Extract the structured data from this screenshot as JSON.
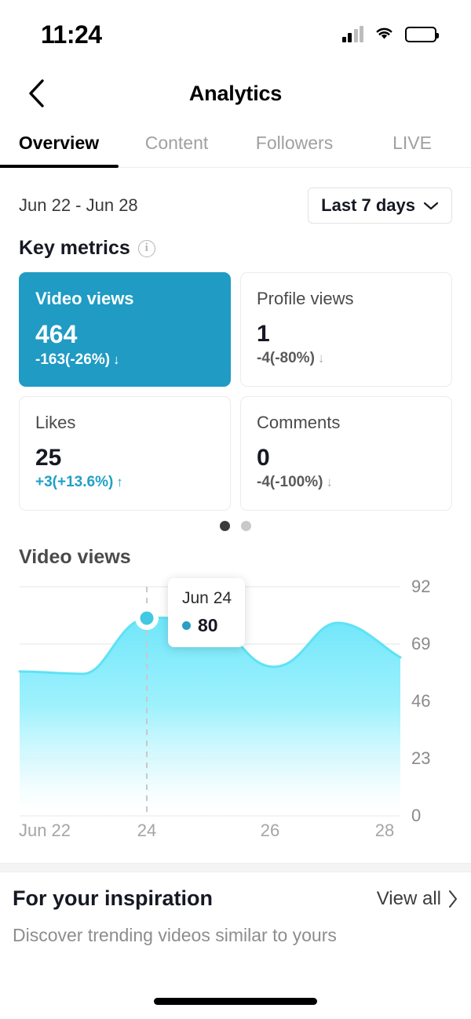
{
  "status_bar": {
    "time": "11:24",
    "signal_icon": "cellular-signal-icon",
    "wifi_icon": "wifi-icon",
    "battery_icon": "battery-icon"
  },
  "nav": {
    "back_icon": "chevron-left-icon",
    "title": "Analytics"
  },
  "tabs": [
    {
      "label": "Overview",
      "active": true
    },
    {
      "label": "Content",
      "active": false
    },
    {
      "label": "Followers",
      "active": false
    },
    {
      "label": "LIVE",
      "active": false
    }
  ],
  "date_row": {
    "range_text": "Jun 22 - Jun 28",
    "picker_label": "Last 7 days",
    "picker_icon": "chevron-down-icon"
  },
  "key_metrics": {
    "heading": "Key metrics",
    "info_icon": "info-circle-icon",
    "info_glyph": "i",
    "cards": [
      {
        "title": "Video views",
        "value": "464",
        "delta": "-163(-26%)",
        "direction": "down",
        "arrow": "↓",
        "selected": true
      },
      {
        "title": "Profile views",
        "value": "1",
        "delta": "-4(-80%)",
        "direction": "down",
        "arrow": "↓",
        "selected": false
      },
      {
        "title": "Likes",
        "value": "25",
        "delta": "+3(+13.6%)",
        "direction": "up",
        "arrow": "↑",
        "selected": false
      },
      {
        "title": "Comments",
        "value": "0",
        "delta": "-4(-100%)",
        "direction": "down",
        "arrow": "↓",
        "selected": false
      }
    ],
    "pager": {
      "total": 2,
      "active_index": 0
    }
  },
  "chart_section": {
    "title": "Video views",
    "tooltip": {
      "date": "Jun 24",
      "value": "80",
      "marker_color": "#2a9ec6"
    }
  },
  "chart_data": {
    "type": "area",
    "title": "Video views",
    "xlabel": "",
    "ylabel": "",
    "x": [
      "Jun 22",
      "Jun 23",
      "Jun 24",
      "Jun 25",
      "Jun 26",
      "Jun 27",
      "Jun 28"
    ],
    "tick_labels_x": [
      "Jun 22",
      "24",
      "26",
      "28"
    ],
    "tick_labels_y": [
      "92",
      "69",
      "46",
      "23",
      "0"
    ],
    "ylim": [
      0,
      92
    ],
    "yticks": [
      0,
      23,
      46,
      69,
      92
    ],
    "grid": true,
    "legend": "none",
    "series": [
      {
        "name": "Video views",
        "values": [
          56,
          55,
          80,
          78,
          58,
          75,
          62
        ],
        "line_color": "#5fe2f5",
        "fill_top_color": "#7fe9fb",
        "fill_bottom_color": "#ffffff"
      }
    ],
    "highlight": {
      "x": "Jun 24",
      "y": 80,
      "marker": "circle",
      "guideline": "dashed-vertical"
    }
  },
  "inspiration": {
    "title": "For your inspiration",
    "view_all_label": "View all",
    "view_all_icon": "chevron-right-icon",
    "subtitle": "Discover trending videos similar to yours"
  },
  "colors": {
    "accent_teal": "#1f9bc4",
    "chart_cyan": "#5fe2f5",
    "up_green_teal": "#20a0c7",
    "text_primary": "#161823",
    "text_muted": "#8a8a8a"
  }
}
